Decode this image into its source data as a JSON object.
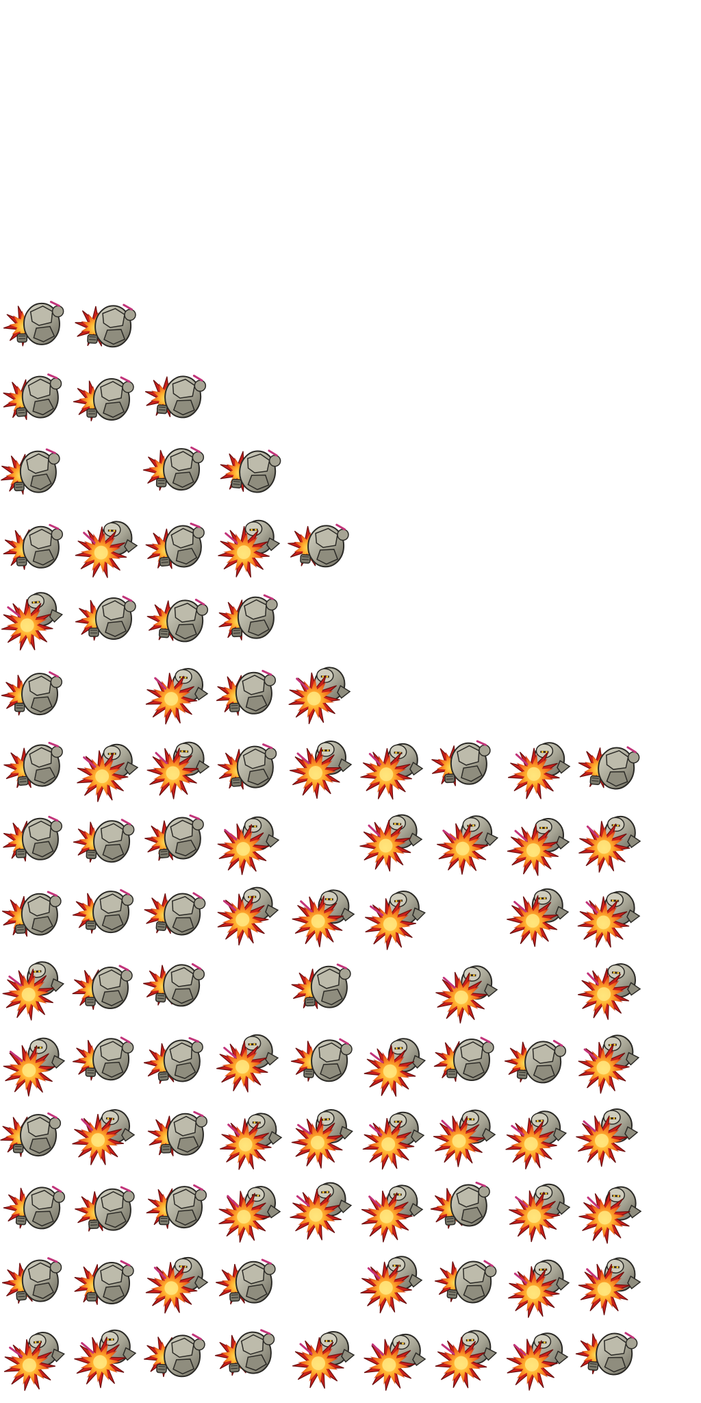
{
  "sprite_sheet": {
    "subject": "golem-with-spiked-fire-crystal",
    "palette": {
      "stone_light": "#c9c8b8",
      "stone_mid": "#9e9c8c",
      "stone_dark": "#5f5d52",
      "outline": "#2b2a26",
      "flame_outer": "#d8261a",
      "flame_mid": "#f06a1e",
      "flame_core": "#ffd23a",
      "spike_accent": "#c2347a"
    },
    "rows": [
      [
        "back",
        "back",
        null,
        null,
        null,
        null,
        null,
        null,
        null
      ],
      [
        "back",
        "back",
        "back",
        null,
        null,
        null,
        null,
        null,
        null
      ],
      [
        "back",
        null,
        "back",
        "back",
        null,
        null,
        null,
        null,
        null
      ],
      [
        "back",
        "front",
        "back",
        "front",
        "back",
        null,
        null,
        null,
        null
      ],
      [
        "front",
        "back",
        "back",
        "back",
        null,
        null,
        null,
        null,
        null
      ],
      [
        "back",
        null,
        "front",
        "back",
        "front",
        null,
        null,
        null,
        null
      ],
      [
        "back",
        "front",
        "front",
        "back",
        "front",
        "front",
        "back",
        "front",
        "back"
      ],
      [
        "back",
        "back",
        "back",
        "front",
        null,
        "front",
        "front",
        "front",
        "front"
      ],
      [
        "back",
        "back",
        "back",
        "front",
        "front",
        "front",
        null,
        "front",
        "front"
      ],
      [
        "front",
        "back",
        "back",
        null,
        "back",
        null,
        "front",
        null,
        "front"
      ],
      [
        "front",
        "back",
        "back",
        "front",
        "back",
        "front",
        "back",
        "back",
        "front"
      ],
      [
        "back",
        "front",
        "back",
        "front",
        "front",
        "front",
        "front",
        "front",
        "front"
      ],
      [
        "back",
        "back",
        "back",
        "front",
        "front",
        "front",
        "back",
        "front",
        "front"
      ],
      [
        "back",
        "back",
        "front",
        "back",
        null,
        "front",
        "back",
        "front",
        "front"
      ],
      [
        "front",
        "front",
        "back",
        "back",
        "front",
        "front",
        "front",
        "front",
        "back"
      ]
    ]
  }
}
